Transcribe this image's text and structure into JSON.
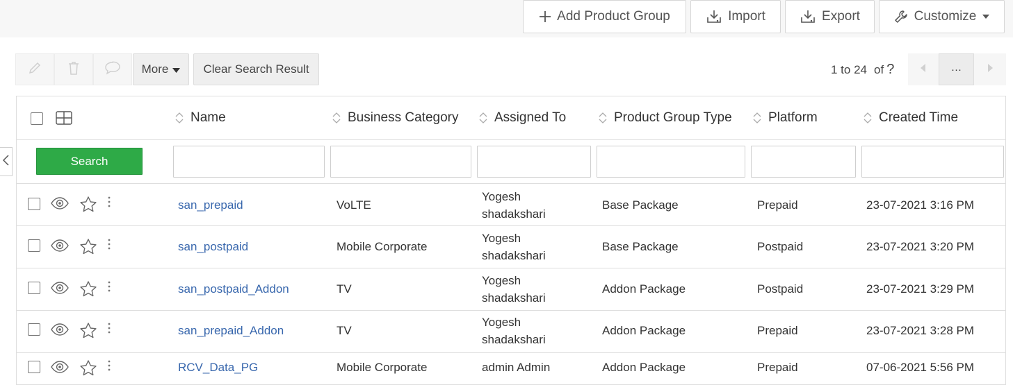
{
  "header_actions": {
    "add_product_group": "Add Product Group",
    "import": "Import",
    "export": "Export",
    "customize": "Customize"
  },
  "toolbar": {
    "more": "More",
    "clear_search": "Clear Search Result",
    "edit_icon": "pencil-icon",
    "delete_icon": "trash-icon",
    "comment_icon": "comment-icon"
  },
  "pagination": {
    "range": "1 to 24",
    "of": "of",
    "total": "?",
    "more": "···"
  },
  "table": {
    "columns": [
      "Name",
      "Business Category",
      "Assigned To",
      "Product Group Type",
      "Platform",
      "Created Time"
    ],
    "search_label": "Search",
    "rows": [
      {
        "name": "san_prepaid",
        "category": "VoLTE",
        "assigned_line1": "Yogesh",
        "assigned_line2": "shadakshari",
        "type": "Base Package",
        "platform": "Prepaid",
        "created": "23-07-2021 3:16 PM"
      },
      {
        "name": "san_postpaid",
        "category": "Mobile Corporate",
        "assigned_line1": "Yogesh",
        "assigned_line2": "shadakshari",
        "type": "Base Package",
        "platform": "Postpaid",
        "created": "23-07-2021 3:20 PM"
      },
      {
        "name": "san_postpaid_Addon",
        "category": "TV",
        "assigned_line1": "Yogesh",
        "assigned_line2": "shadakshari",
        "type": "Addon Package",
        "platform": "Postpaid",
        "created": "23-07-2021 3:29 PM"
      },
      {
        "name": "san_prepaid_Addon",
        "category": "TV",
        "assigned_line1": "Yogesh",
        "assigned_line2": "shadakshari",
        "type": "Addon Package",
        "platform": "Prepaid",
        "created": "23-07-2021 3:28 PM"
      },
      {
        "name": "RCV_Data_PG",
        "category": "Mobile Corporate",
        "assigned_line1": "admin Admin",
        "assigned_line2": "",
        "type": "Addon Package",
        "platform": "Prepaid",
        "created": "07-06-2021 5:56 PM"
      }
    ]
  },
  "colors": {
    "search_button": "#2eaa47",
    "link": "#3867ad"
  }
}
